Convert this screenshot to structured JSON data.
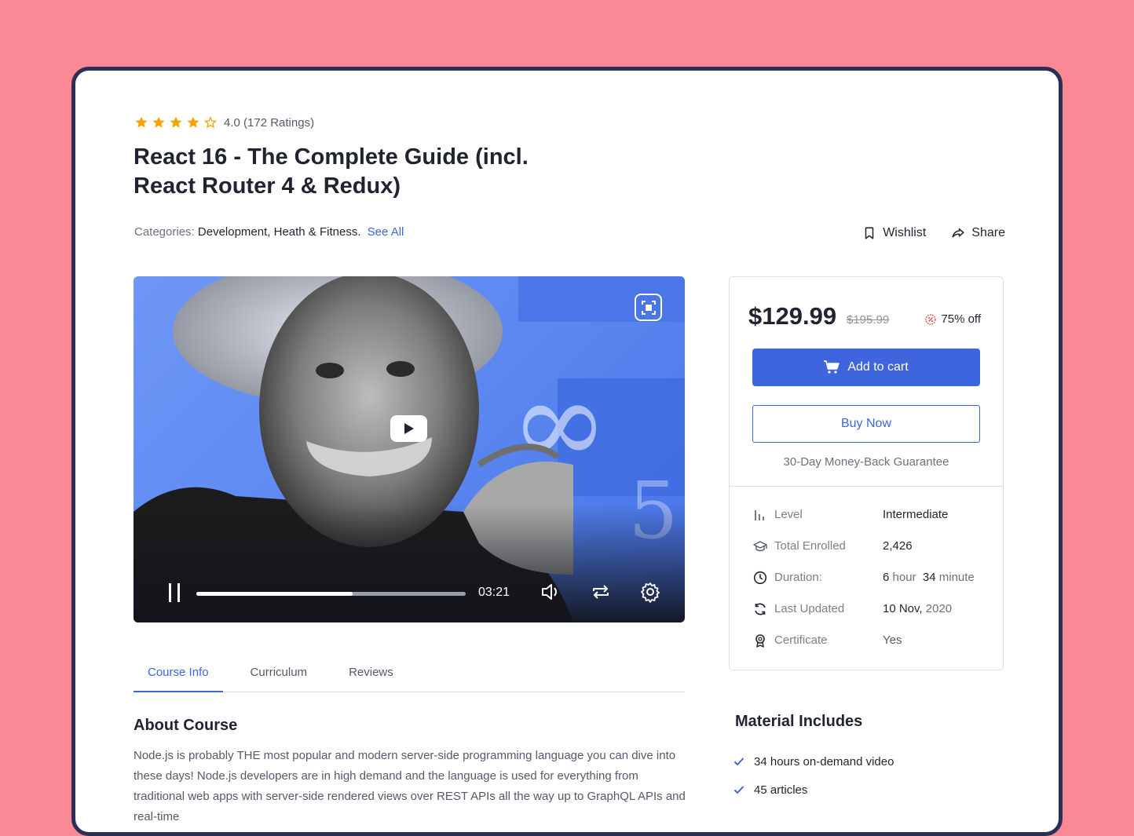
{
  "course": {
    "rating": {
      "value": 4.0,
      "stars_filled": 4,
      "stars_total": 5,
      "text": "4.0 (172 Ratings)"
    },
    "title": "React 16 - The Complete Guide (incl. React Router 4 & Redux)",
    "categories_label": "Categories:",
    "categories_values": "Development, Heath & Fitness.",
    "see_all": "See All"
  },
  "actions": {
    "wishlist": "Wishlist",
    "share": "Share"
  },
  "video": {
    "time": "03:21",
    "progress": 0.58,
    "icons": [
      "fullscreen-icon",
      "play-icon",
      "pause-icon",
      "volume-icon",
      "repeat-icon",
      "settings-icon"
    ]
  },
  "tabs": [
    {
      "label": "Course Info",
      "active": true
    },
    {
      "label": "Curriculum",
      "active": false
    },
    {
      "label": "Reviews",
      "active": false
    }
  ],
  "about": {
    "heading": "About Course",
    "text": "Node.js is probably THE most popular and modern server-side programming language you can dive into these days! Node.js developers are in high demand and the language is used for everything from traditional web apps with server-side rendered views over REST APIs all the way up to GraphQL APIs and real-time"
  },
  "pricing": {
    "price": "$129.99",
    "old_price": "$195.99",
    "discount": "75% off",
    "add_to_cart": "Add to cart",
    "buy_now": "Buy Now",
    "guarantee": "30-Day Money-Back Guarantee"
  },
  "meta": {
    "level": {
      "label": "Level",
      "value": "Intermediate"
    },
    "enrolled": {
      "label": "Total Enrolled",
      "value": "2,426"
    },
    "duration": {
      "label": "Duration:",
      "hours": "6",
      "hours_unit": "hour",
      "minutes": "34",
      "minutes_unit": "minute"
    },
    "updated": {
      "label": "Last Updated",
      "day_month": "10 Nov,",
      "year": "2020"
    },
    "certificate": {
      "label": "Certificate",
      "value": "Yes"
    }
  },
  "materials": {
    "heading": "Material Includes",
    "items": [
      "34 hours on-demand video",
      "45 articles"
    ]
  },
  "colors": {
    "accent": "#3E64DE",
    "star": "#F5A100",
    "background": "#FA8895",
    "frame_border": "#2A2F55"
  }
}
